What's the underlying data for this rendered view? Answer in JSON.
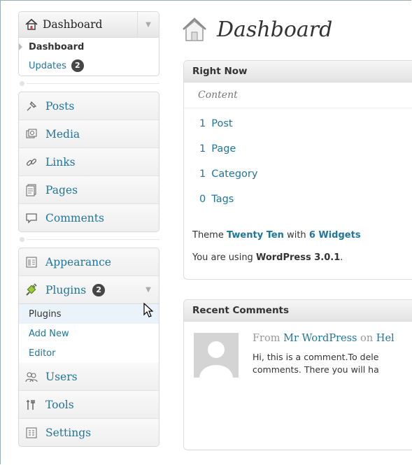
{
  "sidebar": {
    "dashboard": {
      "label": "Dashboard",
      "submenu": [
        {
          "label": "Dashboard"
        },
        {
          "label": "Updates",
          "badge": "2"
        }
      ]
    },
    "content_items": [
      {
        "label": "Posts",
        "icon": "pushpin-icon"
      },
      {
        "label": "Media",
        "icon": "media-icon"
      },
      {
        "label": "Links",
        "icon": "link-icon"
      },
      {
        "label": "Pages",
        "icon": "pages-icon"
      },
      {
        "label": "Comments",
        "icon": "comments-icon"
      }
    ],
    "appearance": {
      "label": "Appearance"
    },
    "plugins": {
      "label": "Plugins",
      "badge": "2",
      "submenu": [
        {
          "label": "Plugins"
        },
        {
          "label": "Add New"
        },
        {
          "label": "Editor"
        }
      ]
    },
    "users": {
      "label": "Users"
    },
    "tools": {
      "label": "Tools"
    },
    "settings": {
      "label": "Settings"
    }
  },
  "main": {
    "title": "Dashboard",
    "right_now": {
      "heading": "Right Now",
      "content_label": "Content",
      "stats": [
        {
          "count": "1",
          "label": "Post"
        },
        {
          "count": "1",
          "label": "Page"
        },
        {
          "count": "1",
          "label": "Category"
        },
        {
          "count": "0",
          "label": "Tags"
        }
      ],
      "theme_prefix": "Theme",
      "theme_name": "Twenty Ten",
      "theme_with": "with",
      "widgets": "6 Widgets",
      "version_prefix": "You are using",
      "version": "WordPress 3.0.1",
      "version_suffix": "."
    },
    "recent_comments": {
      "heading": "Recent Comments",
      "from": "From",
      "author": "Mr WordPress",
      "on": "on",
      "post": "Hel",
      "line1": "Hi, this is a comment.To dele",
      "line2": "comments. There you will ha"
    }
  },
  "colors": {
    "link": "#21759b",
    "badge": "#464646"
  }
}
